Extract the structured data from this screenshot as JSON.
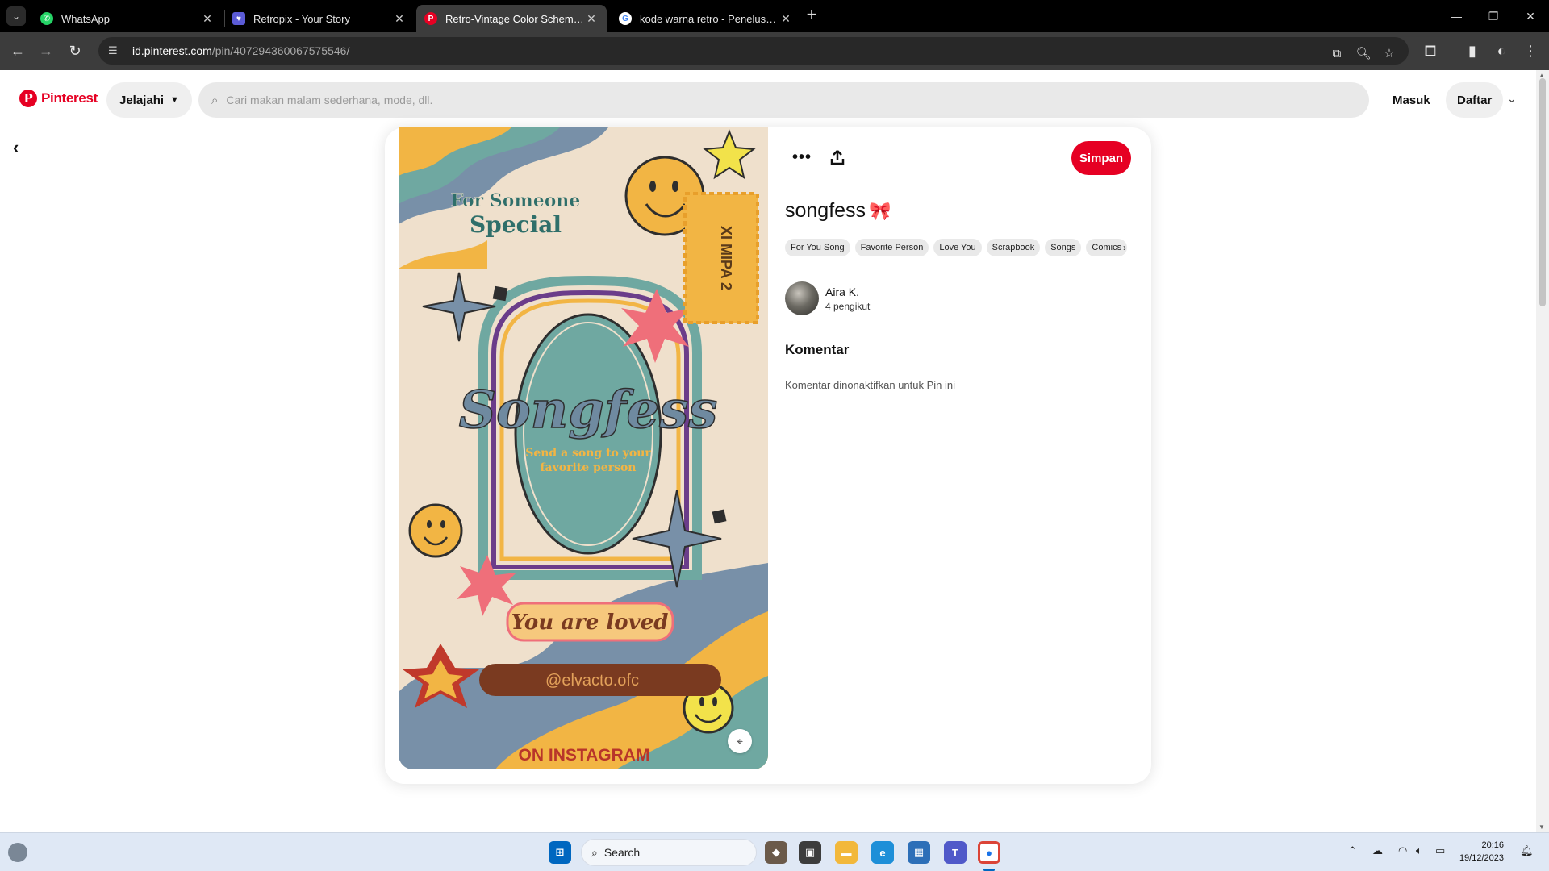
{
  "browser": {
    "tabs": [
      {
        "title": "WhatsApp",
        "favicon": "whatsapp-icon",
        "color": "#25d366",
        "active": false
      },
      {
        "title": "Retropix - Your Story",
        "favicon": "retropix-icon",
        "color": "#5b5bd6",
        "active": false
      },
      {
        "title": "Retro-Vintage Color Scheme » I",
        "favicon": "pinterest-icon",
        "color": "#e60023",
        "active": true
      },
      {
        "title": "kode warna retro - Penelusuran",
        "favicon": "google-icon",
        "color": "#ffffff",
        "active": false
      }
    ],
    "url_host": "id.pinterest.com",
    "url_path": "/pin/407294360067575546/"
  },
  "header": {
    "logo_text": "Pinterest",
    "explore_label": "Jelajahi",
    "search_placeholder": "Cari makan malam sederhana, mode, dll.",
    "login_label": "Masuk",
    "signup_label": "Daftar"
  },
  "pin": {
    "save_label": "Simpan",
    "title": "songfess",
    "title_emoji": "🎀",
    "tags": [
      "For You Song",
      "Favorite Person",
      "Love You",
      "Scrapbook",
      "Songs",
      "Comics"
    ],
    "author": {
      "name": "Aira K.",
      "followers": "4 pengikut"
    },
    "comments_heading": "Komentar",
    "comments_status": "Komentar dinonaktifkan untuk Pin ini",
    "image_text": {
      "top": "For Someone Special",
      "ticket": "XI MIPA 2",
      "center": "Songfess",
      "sub_line1": "Send a song to your",
      "sub_line2": "favorite person",
      "loved": "You are loved",
      "handle": "@elvacto.ofc",
      "bottom": "ON INSTAGRAM"
    }
  },
  "taskbar": {
    "search_label": "Search",
    "time": "20:16",
    "date": "19/12/2023"
  },
  "colors": {
    "pinterest_red": "#e60023",
    "poster_bg": "#efe0cc",
    "poster_teal": "#6fa8a1",
    "poster_yellow": "#f2b544",
    "poster_blue": "#7890a8"
  }
}
